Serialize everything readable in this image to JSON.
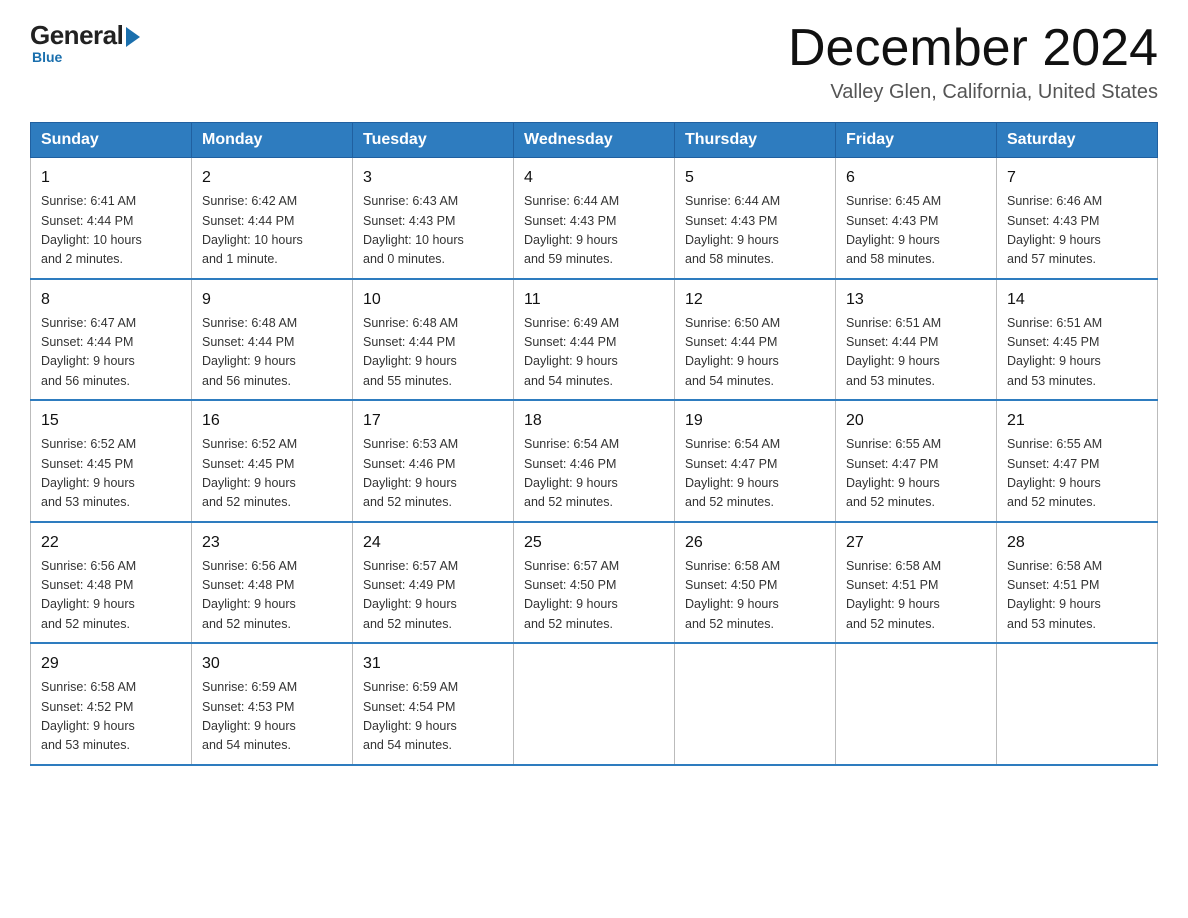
{
  "header": {
    "logo": {
      "general": "General",
      "blue": "Blue"
    },
    "title": "December 2024",
    "location": "Valley Glen, California, United States"
  },
  "calendar": {
    "days_of_week": [
      "Sunday",
      "Monday",
      "Tuesday",
      "Wednesday",
      "Thursday",
      "Friday",
      "Saturday"
    ],
    "weeks": [
      [
        {
          "day": "1",
          "sunrise": "6:41 AM",
          "sunset": "4:44 PM",
          "daylight": "10 hours and 2 minutes."
        },
        {
          "day": "2",
          "sunrise": "6:42 AM",
          "sunset": "4:44 PM",
          "daylight": "10 hours and 1 minute."
        },
        {
          "day": "3",
          "sunrise": "6:43 AM",
          "sunset": "4:43 PM",
          "daylight": "10 hours and 0 minutes."
        },
        {
          "day": "4",
          "sunrise": "6:44 AM",
          "sunset": "4:43 PM",
          "daylight": "9 hours and 59 minutes."
        },
        {
          "day": "5",
          "sunrise": "6:44 AM",
          "sunset": "4:43 PM",
          "daylight": "9 hours and 58 minutes."
        },
        {
          "day": "6",
          "sunrise": "6:45 AM",
          "sunset": "4:43 PM",
          "daylight": "9 hours and 58 minutes."
        },
        {
          "day": "7",
          "sunrise": "6:46 AM",
          "sunset": "4:43 PM",
          "daylight": "9 hours and 57 minutes."
        }
      ],
      [
        {
          "day": "8",
          "sunrise": "6:47 AM",
          "sunset": "4:44 PM",
          "daylight": "9 hours and 56 minutes."
        },
        {
          "day": "9",
          "sunrise": "6:48 AM",
          "sunset": "4:44 PM",
          "daylight": "9 hours and 56 minutes."
        },
        {
          "day": "10",
          "sunrise": "6:48 AM",
          "sunset": "4:44 PM",
          "daylight": "9 hours and 55 minutes."
        },
        {
          "day": "11",
          "sunrise": "6:49 AM",
          "sunset": "4:44 PM",
          "daylight": "9 hours and 54 minutes."
        },
        {
          "day": "12",
          "sunrise": "6:50 AM",
          "sunset": "4:44 PM",
          "daylight": "9 hours and 54 minutes."
        },
        {
          "day": "13",
          "sunrise": "6:51 AM",
          "sunset": "4:44 PM",
          "daylight": "9 hours and 53 minutes."
        },
        {
          "day": "14",
          "sunrise": "6:51 AM",
          "sunset": "4:45 PM",
          "daylight": "9 hours and 53 minutes."
        }
      ],
      [
        {
          "day": "15",
          "sunrise": "6:52 AM",
          "sunset": "4:45 PM",
          "daylight": "9 hours and 53 minutes."
        },
        {
          "day": "16",
          "sunrise": "6:52 AM",
          "sunset": "4:45 PM",
          "daylight": "9 hours and 52 minutes."
        },
        {
          "day": "17",
          "sunrise": "6:53 AM",
          "sunset": "4:46 PM",
          "daylight": "9 hours and 52 minutes."
        },
        {
          "day": "18",
          "sunrise": "6:54 AM",
          "sunset": "4:46 PM",
          "daylight": "9 hours and 52 minutes."
        },
        {
          "day": "19",
          "sunrise": "6:54 AM",
          "sunset": "4:47 PM",
          "daylight": "9 hours and 52 minutes."
        },
        {
          "day": "20",
          "sunrise": "6:55 AM",
          "sunset": "4:47 PM",
          "daylight": "9 hours and 52 minutes."
        },
        {
          "day": "21",
          "sunrise": "6:55 AM",
          "sunset": "4:47 PM",
          "daylight": "9 hours and 52 minutes."
        }
      ],
      [
        {
          "day": "22",
          "sunrise": "6:56 AM",
          "sunset": "4:48 PM",
          "daylight": "9 hours and 52 minutes."
        },
        {
          "day": "23",
          "sunrise": "6:56 AM",
          "sunset": "4:48 PM",
          "daylight": "9 hours and 52 minutes."
        },
        {
          "day": "24",
          "sunrise": "6:57 AM",
          "sunset": "4:49 PM",
          "daylight": "9 hours and 52 minutes."
        },
        {
          "day": "25",
          "sunrise": "6:57 AM",
          "sunset": "4:50 PM",
          "daylight": "9 hours and 52 minutes."
        },
        {
          "day": "26",
          "sunrise": "6:58 AM",
          "sunset": "4:50 PM",
          "daylight": "9 hours and 52 minutes."
        },
        {
          "day": "27",
          "sunrise": "6:58 AM",
          "sunset": "4:51 PM",
          "daylight": "9 hours and 52 minutes."
        },
        {
          "day": "28",
          "sunrise": "6:58 AM",
          "sunset": "4:51 PM",
          "daylight": "9 hours and 53 minutes."
        }
      ],
      [
        {
          "day": "29",
          "sunrise": "6:58 AM",
          "sunset": "4:52 PM",
          "daylight": "9 hours and 53 minutes."
        },
        {
          "day": "30",
          "sunrise": "6:59 AM",
          "sunset": "4:53 PM",
          "daylight": "9 hours and 54 minutes."
        },
        {
          "day": "31",
          "sunrise": "6:59 AM",
          "sunset": "4:54 PM",
          "daylight": "9 hours and 54 minutes."
        },
        null,
        null,
        null,
        null
      ]
    ],
    "labels": {
      "sunrise": "Sunrise:",
      "sunset": "Sunset:",
      "daylight": "Daylight:"
    }
  }
}
